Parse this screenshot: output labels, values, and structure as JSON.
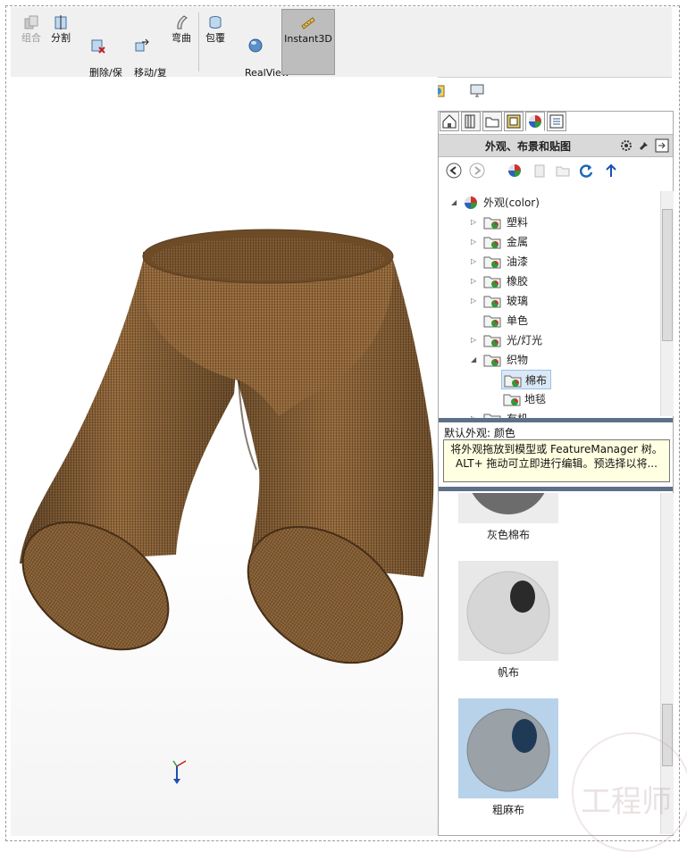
{
  "toolbar": {
    "buttons": [
      {
        "label": "组合",
        "icon": "combine-icon",
        "disabled": true
      },
      {
        "label": "分割",
        "icon": "split-icon",
        "disabled": false
      },
      {
        "label": "删除/保\n留实体",
        "icon": "delete-keep-body-icon",
        "disabled": false
      },
      {
        "label": "移动/复\n制实体",
        "icon": "move-copy-body-icon",
        "disabled": false
      },
      {
        "label": "弯曲",
        "icon": "flex-icon",
        "disabled": false
      },
      {
        "label": "包覆",
        "icon": "wrap-icon",
        "disabled": false
      },
      {
        "label": "RealView\n图形",
        "icon": "realview-icon",
        "disabled": false
      },
      {
        "label": "Instant3D",
        "icon": "instant3d-icon",
        "disabled": false,
        "active": true
      }
    ]
  },
  "task_pane": {
    "title": "外观、布景和贴图",
    "tree": [
      {
        "label": "外观(color)",
        "level": 0,
        "expanded": true
      },
      {
        "label": "塑料",
        "level": 1
      },
      {
        "label": "金属",
        "level": 1
      },
      {
        "label": "油漆",
        "level": 1
      },
      {
        "label": "橡胶",
        "level": 1
      },
      {
        "label": "玻璃",
        "level": 1
      },
      {
        "label": "单色",
        "level": 1,
        "leaf": true
      },
      {
        "label": "光/灯光",
        "level": 1
      },
      {
        "label": "织物",
        "level": 1,
        "expanded": true
      },
      {
        "label": "棉布",
        "level": 2,
        "selected": true
      },
      {
        "label": "地毯",
        "level": 2
      },
      {
        "label": "有机",
        "level": 1
      }
    ],
    "description": "默认外观: 颜色",
    "tooltip": "将外观拖放到模型或 FeatureManager 树。ALT+ 拖动可立即进行编辑。预选择以将...",
    "gallery": [
      {
        "label": "灰色棉布",
        "color": "#6c6c6c"
      },
      {
        "label": "帆布",
        "color": "#d6d6d6"
      },
      {
        "label": "粗麻布",
        "color": "#9aa2a8"
      }
    ]
  },
  "watermark": {
    "text": "工程师"
  },
  "colors": {
    "fabric": "#8a6238",
    "fabric_dark": "#5a3d20",
    "accent_blue": "#1a4fb5",
    "tooltip_bg": "#ffffe1"
  }
}
